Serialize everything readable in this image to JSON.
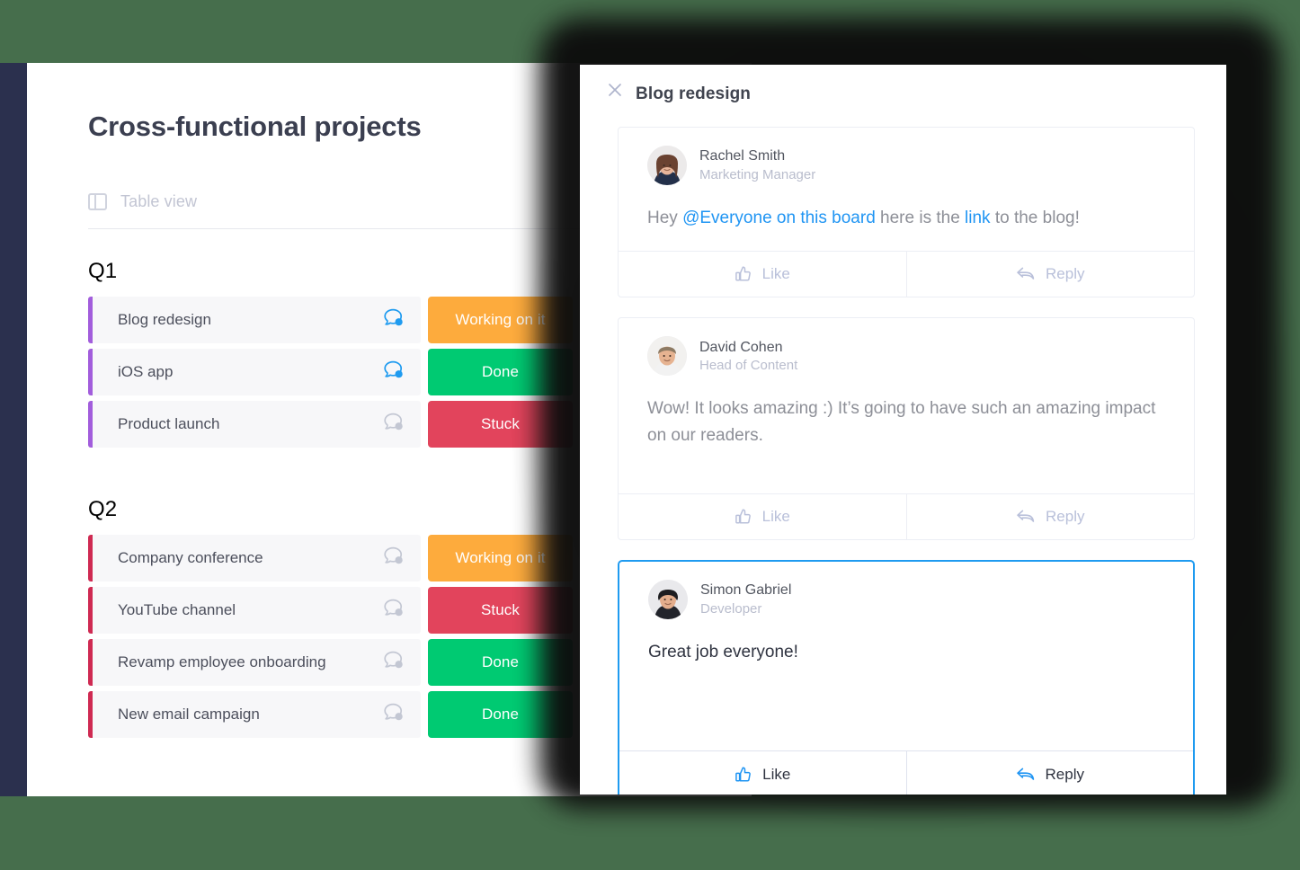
{
  "board": {
    "title": "Cross-functional projects",
    "view_tab": {
      "label": "Table view",
      "icon": "table-icon"
    },
    "groups": [
      {
        "name": "Q1",
        "color": "#a25ddc",
        "items": [
          {
            "name": "Blog redesign",
            "status": "Working on it",
            "status_color": "#fdab3d",
            "chat_icon": "chat-bubble-icon",
            "chat_unread": true
          },
          {
            "name": "iOS app",
            "status": "Done",
            "status_color": "#00ca72",
            "chat_icon": "chat-bubble-icon",
            "chat_unread": true
          },
          {
            "name": "Product launch",
            "status": "Stuck",
            "status_color": "#e2445c",
            "chat_icon": "chat-bubble-icon",
            "chat_unread": false
          }
        ]
      },
      {
        "name": "Q2",
        "color": "#cf2a52",
        "items": [
          {
            "name": "Company conference",
            "status": "Working on it",
            "status_color": "#fdab3d",
            "chat_icon": "chat-bubble-icon",
            "chat_unread": false
          },
          {
            "name": "YouTube channel",
            "status": "Stuck",
            "status_color": "#e2445c",
            "chat_icon": "chat-bubble-icon",
            "chat_unread": false
          },
          {
            "name": "Revamp employee onboarding",
            "status": "Done",
            "status_color": "#00ca72",
            "chat_icon": "chat-bubble-icon",
            "chat_unread": false
          },
          {
            "name": "New email campaign",
            "status": "Done",
            "status_color": "#00ca72",
            "chat_icon": "chat-bubble-icon",
            "chat_unread": false
          }
        ]
      }
    ]
  },
  "modal": {
    "title": "Blog redesign",
    "close_icon": "close-icon",
    "like_label": "Like",
    "reply_label": "Reply",
    "like_icon": "thumbs-up-icon",
    "reply_icon": "reply-arrow-icon",
    "highlight_color": "#1f9bf0",
    "comments": [
      {
        "author": "Rachel Smith",
        "role": "Marketing Manager",
        "avatar": "avatar-rachel-smith",
        "text_parts": [
          {
            "text": "Hey ",
            "type": "plain"
          },
          {
            "text": "@Everyone on this board",
            "type": "mention"
          },
          {
            "text": " here is the ",
            "type": "plain"
          },
          {
            "text": "link",
            "type": "link"
          },
          {
            "text": " to the blog!",
            "type": "plain"
          }
        ],
        "highlighted": false
      },
      {
        "author": "David Cohen",
        "role": "Head of Content",
        "avatar": "avatar-david-cohen",
        "text_parts": [
          {
            "text": "Wow! It looks amazing :) It’s going to have such an amazing impact on our readers.",
            "type": "plain"
          }
        ],
        "highlighted": false
      },
      {
        "author": "Simon Gabriel",
        "role": "Developer",
        "avatar": "avatar-simon-gabriel",
        "text_parts": [
          {
            "text": "Great job everyone!",
            "type": "plain"
          }
        ],
        "highlighted": true
      }
    ]
  },
  "theme": {
    "page_background": "#466e4c",
    "rail_color": "#2b304e",
    "row_background": "#f7f7f9"
  }
}
